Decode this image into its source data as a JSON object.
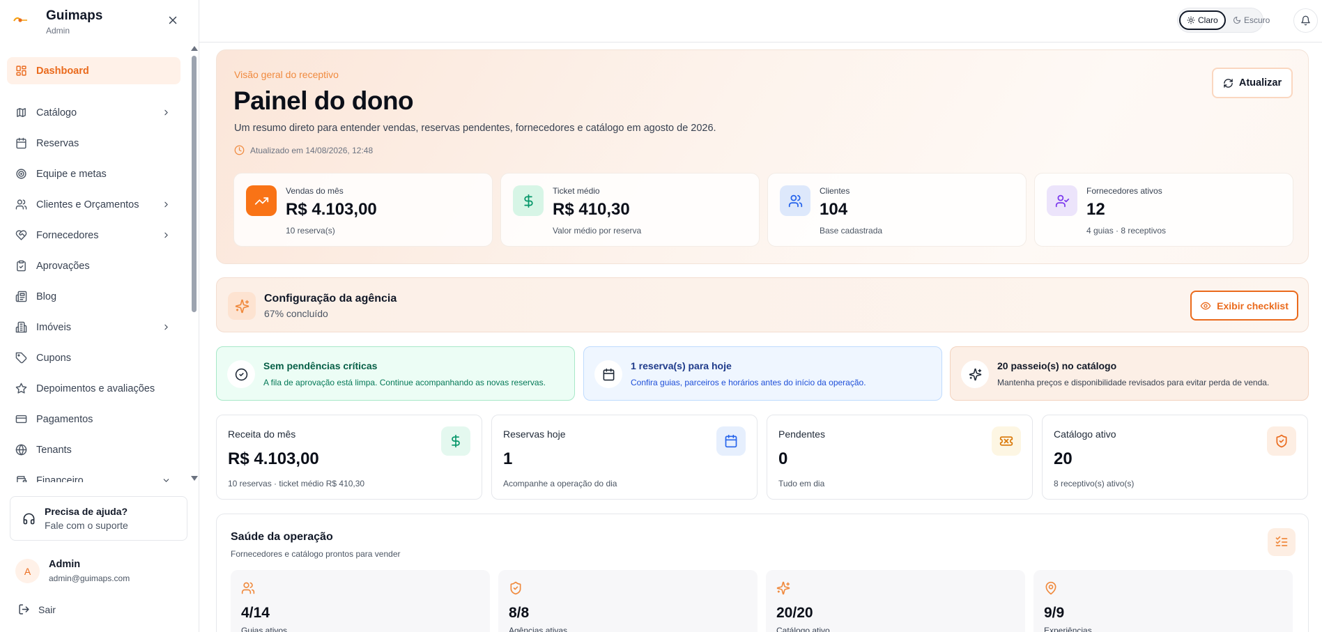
{
  "sidebar": {
    "brand": {
      "name": "Guimaps",
      "subtitle": "Admin",
      "logo_icon": "guimaps-logo"
    },
    "nav": [
      {
        "label": "Dashboard",
        "icon": "layout-grid-icon",
        "active": true
      },
      {
        "label": "Catálogo",
        "icon": "compass-icon",
        "expandable": true
      },
      {
        "label": "Reservas",
        "icon": "calendar-icon"
      },
      {
        "label": "Equipe e metas",
        "icon": "target-icon"
      },
      {
        "label": "Clientes e Orçamentos",
        "icon": "users-icon",
        "expandable": true
      },
      {
        "label": "Fornecedores",
        "icon": "handshake-icon",
        "expandable": true
      },
      {
        "label": "Aprovações",
        "icon": "clipboard-check-icon"
      },
      {
        "label": "Blog",
        "icon": "newspaper-icon"
      },
      {
        "label": "Imóveis",
        "icon": "building-icon",
        "expandable": true
      },
      {
        "label": "Cupons",
        "icon": "tag-icon"
      },
      {
        "label": "Depoimentos e avaliações",
        "icon": "star-icon"
      },
      {
        "label": "Pagamentos",
        "icon": "credit-card-icon"
      },
      {
        "label": "Tenants",
        "icon": "globe-icon"
      },
      {
        "label": "Financeiro",
        "icon": "wallet-icon",
        "expandable": true,
        "expanded": true
      }
    ],
    "help": {
      "title": "Precisa de ajuda?",
      "subtitle": "Fale com o suporte"
    },
    "user": {
      "initial": "A",
      "name": "Admin",
      "email": "admin@guimaps.com"
    },
    "logout_label": "Sair"
  },
  "topbar": {
    "theme_light": "Claro",
    "theme_dark": "Escuro"
  },
  "hero": {
    "eyebrow": "Visão geral do receptivo",
    "title": "Painel do dono",
    "description": "Um resumo direto para entender vendas, reservas pendentes, fornecedores e catálogo em agosto de 2026.",
    "updated": "Atualizado em 14/08/2026, 12:48",
    "refresh_label": "Atualizar",
    "kpis": [
      {
        "label": "Vendas do mês",
        "value": "R$ 4.103,00",
        "sub": "10 reserva(s)",
        "icon": "trending-up-icon"
      },
      {
        "label": "Ticket médio",
        "value": "R$ 410,30",
        "sub": "Valor médio por reserva",
        "icon": "dollar-icon"
      },
      {
        "label": "Clientes",
        "value": "104",
        "sub": "Base cadastrada",
        "icon": "users-icon"
      },
      {
        "label": "Fornecedores ativos",
        "value": "12",
        "sub": "4 guias · 8 receptivos",
        "icon": "user-check-icon"
      }
    ]
  },
  "setup": {
    "title": "Configuração da agência",
    "progress": "67% concluído",
    "button_label": "Exibir checklist"
  },
  "alerts": [
    {
      "title": "Sem pendências críticas",
      "text": "A fila de aprovação está limpa. Continue acompanhando as novas reservas.",
      "icon": "check-circle-icon"
    },
    {
      "title": "1 reserva(s) para hoje",
      "text": "Confira guias, parceiros e horários antes do início da operação.",
      "icon": "calendar-icon"
    },
    {
      "title": "20 passeio(s) no catálogo",
      "text": "Mantenha preços e disponibilidade revisados para evitar perda de venda.",
      "icon": "sparkles-icon"
    }
  ],
  "stats": [
    {
      "label": "Receita do mês",
      "value": "R$ 4.103,00",
      "sub": "10 reservas · ticket médio R$ 410,30",
      "icon": "dollar-icon"
    },
    {
      "label": "Reservas hoje",
      "value": "1",
      "sub": "Acompanhe a operação do dia",
      "icon": "calendar-icon"
    },
    {
      "label": "Pendentes",
      "value": "0",
      "sub": "Tudo em dia",
      "icon": "ticket-icon"
    },
    {
      "label": "Catálogo ativo",
      "value": "20",
      "sub": "8 receptivo(s) ativo(s)",
      "icon": "shield-check-icon"
    }
  ],
  "health": {
    "title": "Saúde da operação",
    "subtitle": "Fornecedores e catálogo prontos para vender",
    "cards": [
      {
        "value": "4/14",
        "label": "Guias ativos",
        "icon": "users-icon"
      },
      {
        "value": "8/8",
        "label": "Agências ativas",
        "icon": "shield-check-icon"
      },
      {
        "value": "20/20",
        "label": "Catálogo ativo",
        "icon": "sparkles-icon"
      },
      {
        "value": "9/9",
        "label": "Experiências",
        "icon": "map-pin-icon"
      }
    ]
  },
  "colors": {
    "accent": "#ea6a1c",
    "accent_soft": "#fff1e8",
    "success_bg": "#ecfdf5",
    "info_bg": "#eff6ff",
    "warm_bg": "#fcefe6"
  }
}
